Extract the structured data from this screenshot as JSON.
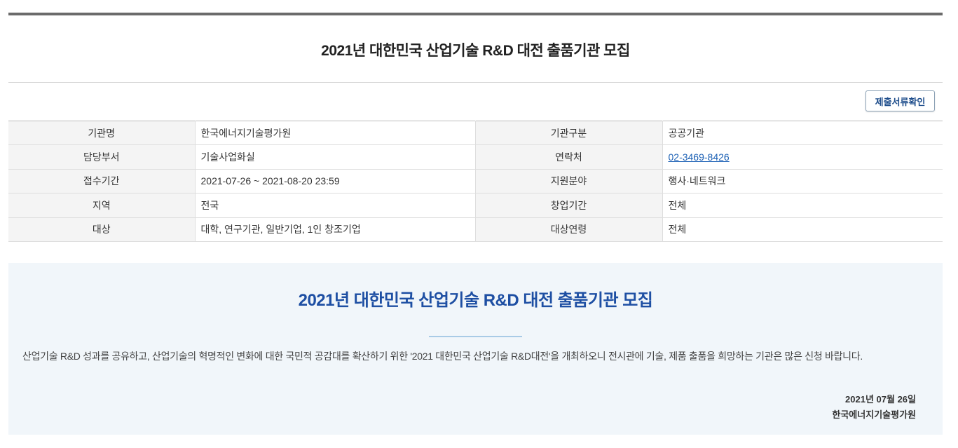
{
  "page": {
    "title": "2021년 대한민국 산업기술 R&D 대전 출품기관 모집"
  },
  "actions": {
    "docs_button": "제출서류확인"
  },
  "info": {
    "rows": [
      {
        "label1": "기관명",
        "value1": "한국에너지기술평가원",
        "label2": "기관구분",
        "value2": "공공기관"
      },
      {
        "label1": "담당부서",
        "value1": "기술사업화실",
        "label2": "연락처",
        "value2": "02-3469-8426"
      },
      {
        "label1": "접수기간",
        "value1": "2021-07-26 ~ 2021-08-20 23:59",
        "label2": "지원분야",
        "value2": "행사·네트워크"
      },
      {
        "label1": "지역",
        "value1": "전국",
        "label2": "창업기간",
        "value2": "전체"
      },
      {
        "label1": "대상",
        "value1": "대학, 연구기관, 일반기업, 1인 창조기업",
        "label2": "대상연령",
        "value2": "전체"
      }
    ]
  },
  "notice": {
    "title": "2021년 대한민국 산업기술 R&D 대전 출품기관 모집",
    "body": "산업기술 R&D 성과를 공유하고, 산업기술의 혁명적인 변화에 대한 국민적 공감대를 확산하기 위한 '2021 대한민국 산업기술 R&D대전'을 개최하오니 전시관에 기술, 제품 출품을 희망하는 기관은 많은 신청 바랍니다.",
    "date": "2021년 07월 26일",
    "org": "한국에너지기술평가원"
  },
  "colors": {
    "accent_blue": "#1e4fa3",
    "link_blue": "#1a5fb4",
    "notice_bg": "#f1f6fa",
    "top_bar": "#6b6b6b"
  }
}
